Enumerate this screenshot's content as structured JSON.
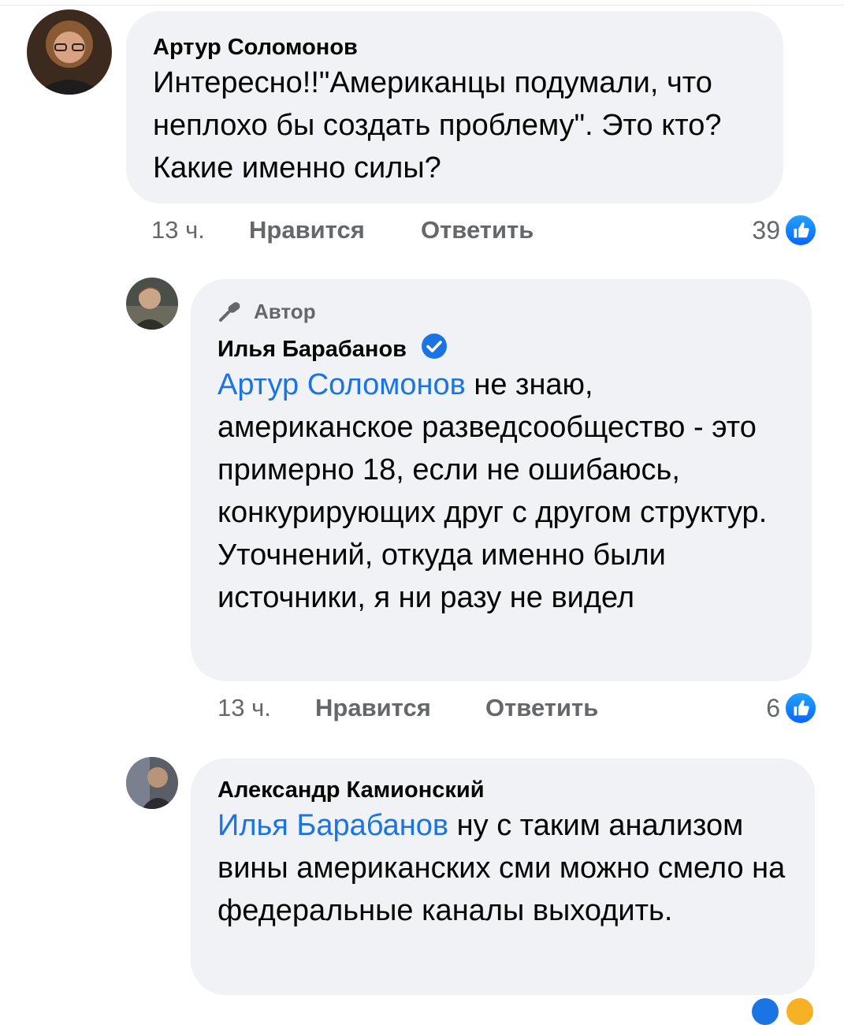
{
  "comments": [
    {
      "author": "Артур Соломонов",
      "text": "Интересно!!\"Американцы подумали, что неплохо бы создать проблему\". Это кто? Какие именно силы?",
      "time": "13 ч.",
      "like_label": "Нравится",
      "reply_label": "Ответить",
      "reaction_count": "39",
      "reaction_icon": "like-icon"
    },
    {
      "author_badge": "Автор",
      "author": "Илья Барабанов",
      "verified_icon": "verified-badge-icon",
      "mention": "Артур Соломонов",
      "text": " не знаю, американское разведсообщество - это примерно 18, если не ошибаюсь, конкурирующих друг с другом структур. Уточнений, откуда именно были источники, я ни разу не видел",
      "time": "13 ч.",
      "like_label": "Нравится",
      "reply_label": "Ответить",
      "reaction_count": "6",
      "reaction_icon": "like-icon"
    },
    {
      "author": "Александр Камионский",
      "mention": "Илья Барабанов",
      "text": " ну с таким анализом вины американских сми можно смело на федеральные каналы выходить."
    }
  ],
  "colors": {
    "bubble": "#f0f2f5",
    "mention": "#1b74e4",
    "meta": "#65676b",
    "like_blue": "#0866ff"
  }
}
